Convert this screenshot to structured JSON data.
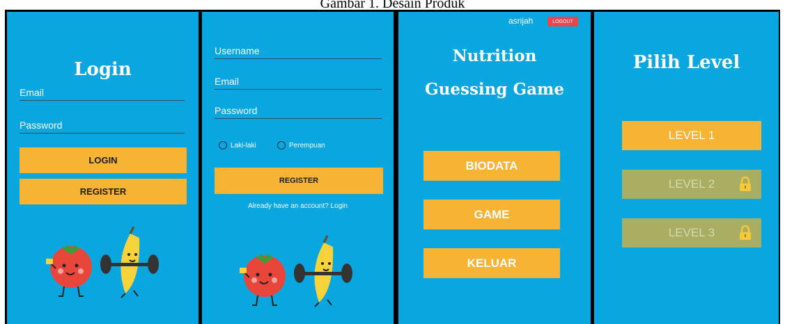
{
  "caption": "Gambar 1. Desain Produk",
  "login_screen": {
    "title": "Login",
    "email_label": "Email",
    "password_label": "Password",
    "login_button": "LOGIN",
    "register_button": "REGISTER",
    "mascot_icon": "tomato-banana-mascot-icon"
  },
  "register_screen": {
    "username_label": "Username",
    "email_label": "Email",
    "password_label": "Password",
    "gender_options": [
      "Laki-laki",
      "Perempuan"
    ],
    "register_button": "REGISTER",
    "login_link": "Already have an account? Login",
    "mascot_icon": "tomato-banana-mascot-icon"
  },
  "menu_screen": {
    "username": "asrijah",
    "logout_button": "LOGOUT",
    "title_line1": "Nutrition",
    "title_line2": "Guessing Game",
    "buttons": [
      "BIODATA",
      "GAME",
      "KELUAR"
    ]
  },
  "level_screen": {
    "title": "Pilih Level",
    "levels": [
      {
        "label": "LEVEL 1",
        "locked": false
      },
      {
        "label": "LEVEL 2",
        "locked": true
      },
      {
        "label": "LEVEL 3",
        "locked": true
      }
    ],
    "lock_icon": "lock-icon"
  },
  "colors": {
    "background": "#0aa6e0",
    "button": "#f7b333",
    "locked_button": "#a9ae62",
    "logout": "#e8474e"
  }
}
